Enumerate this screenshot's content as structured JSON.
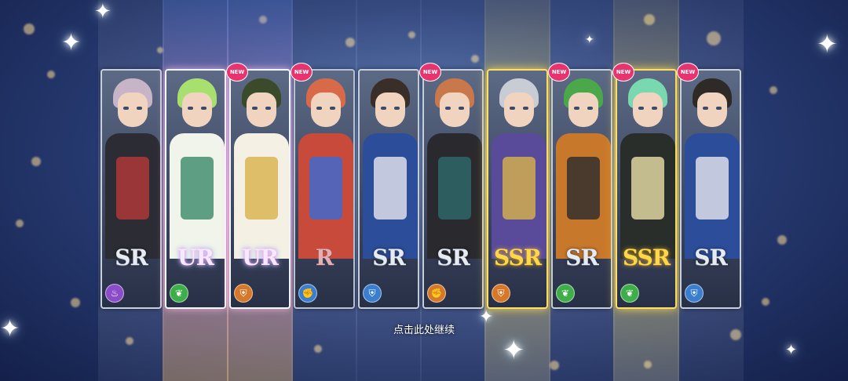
{
  "colors": {
    "new_badge": "#e8336e",
    "ssr_gold": "#ffd84a",
    "ur_glow": "#ff8adc"
  },
  "cards": [
    {
      "rarity": "SR",
      "is_new": false,
      "new_label": "",
      "class_icon": "bowl-icon",
      "icon_color": "#8a4cc8",
      "hair": "#c7b4c6",
      "outfit": "#2c2c34",
      "accent": "#b83a3a"
    },
    {
      "rarity": "UR",
      "is_new": true,
      "new_label": "NEW",
      "class_icon": "leaf-icon",
      "icon_color": "#3fae4a",
      "hair": "#a8e070",
      "outfit": "#f0f4ea",
      "accent": "#3a8a6a"
    },
    {
      "rarity": "UR",
      "is_new": true,
      "new_label": "NEW",
      "class_icon": "shield-icon",
      "icon_color": "#d6782a",
      "hair": "#3a4a2a",
      "outfit": "#f4f0e4",
      "accent": "#d8b24a"
    },
    {
      "rarity": "R",
      "is_new": false,
      "new_label": "",
      "class_icon": "fist-icon",
      "icon_color": "#3a7fcf",
      "hair": "#d86a4a",
      "outfit": "#c84a3a",
      "accent": "#3a6ad8"
    },
    {
      "rarity": "SR",
      "is_new": true,
      "new_label": "NEW",
      "class_icon": "shield-icon",
      "icon_color": "#3a7fcf",
      "hair": "#3a2e28",
      "outfit": "#2c4e9a",
      "accent": "#e8e8f0"
    },
    {
      "rarity": "SR",
      "is_new": false,
      "new_label": "",
      "class_icon": "fist-icon",
      "icon_color": "#d6782a",
      "hair": "#c8784a",
      "outfit": "#2a2a2e",
      "accent": "#2e6a6a"
    },
    {
      "rarity": "SSR",
      "is_new": true,
      "new_label": "NEW",
      "class_icon": "shield-icon",
      "icon_color": "#d6782a",
      "hair": "#c8ccd4",
      "outfit": "#5a4a9a",
      "accent": "#d8b24a"
    },
    {
      "rarity": "SR",
      "is_new": true,
      "new_label": "NEW",
      "class_icon": "leaf-icon",
      "icon_color": "#3fae4a",
      "hair": "#4aa84a",
      "outfit": "#c8782a",
      "accent": "#2a2a2e"
    },
    {
      "rarity": "SSR",
      "is_new": true,
      "new_label": "NEW",
      "class_icon": "leaf-icon",
      "icon_color": "#3fae4a",
      "hair": "#7ad8b0",
      "outfit": "#2a2e2a",
      "accent": "#e8e0a8"
    },
    {
      "rarity": "SR",
      "is_new": false,
      "new_label": "",
      "class_icon": "shield-icon",
      "icon_color": "#3a7fcf",
      "hair": "#2e2a28",
      "outfit": "#2c4e9a",
      "accent": "#e8e8f0"
    }
  ],
  "continue_text": "点击此处继续"
}
